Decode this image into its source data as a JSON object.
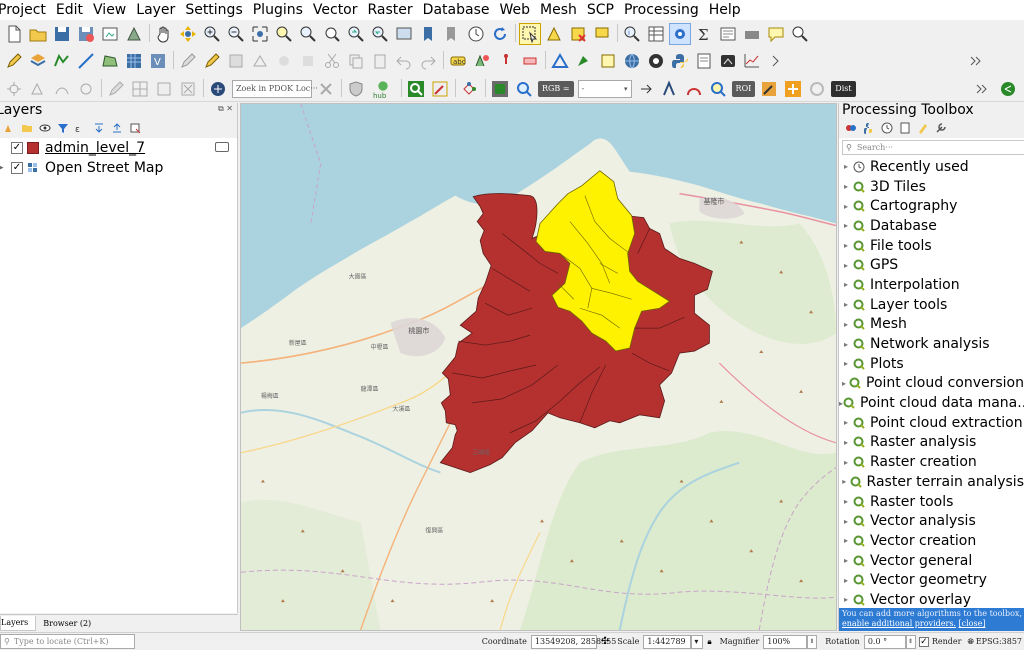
{
  "menu": [
    "Project",
    "Edit",
    "View",
    "Layer",
    "Settings",
    "Plugins",
    "Vector",
    "Raster",
    "Database",
    "Web",
    "Mesh",
    "SCP",
    "Processing",
    "Help"
  ],
  "toolbar3": {
    "pdok_placeholder": "Zoek in PDOK Loc···",
    "hub_label": "hub",
    "rgb_label": "RGB =",
    "roi_label": "ROI",
    "dist_label": "Dist"
  },
  "layers_panel": {
    "title": "Layers",
    "layers": [
      {
        "name": "admin_level_7",
        "checked": true,
        "symbol_color": "#b5312f"
      },
      {
        "name": "Open Street Map",
        "checked": true
      }
    ],
    "tabs": [
      "Layers",
      "Browser (2)"
    ],
    "locate_placeholder": "Type to locate (Ctrl+K)"
  },
  "processing_toolbox": {
    "title": "Processing Toolbox",
    "search_placeholder": "Search···",
    "providers": [
      "Recently used",
      "3D Tiles",
      "Cartography",
      "Database",
      "File tools",
      "GPS",
      "Interpolation",
      "Layer tools",
      "Mesh",
      "Network analysis",
      "Plots",
      "Point cloud conversion",
      "Point cloud data mana...",
      "Point cloud extraction",
      "Raster analysis",
      "Raster creation",
      "Raster terrain analysis",
      "Raster tools",
      "Vector analysis",
      "Vector creation",
      "Vector general",
      "Vector geometry",
      "Vector overlay"
    ],
    "banner_text": "You can add more algorithms to the toolbox,",
    "banner_link": "enable additional providers.",
    "banner_close": "[close]"
  },
  "map": {
    "labels": {
      "city_main": "桃園市",
      "city_north": "基隆市",
      "district_a": "大園區",
      "district_b": "新屋區",
      "district_c": "中壢區",
      "district_d": "楊梅區",
      "district_e": "龍潭區",
      "district_f": "大溪區",
      "district_g": "復興區",
      "district_h": "三峽區"
    },
    "fill_dark": "#b5312f",
    "fill_light": "#fff200"
  },
  "statusbar": {
    "coordinate_label": "Coordinate",
    "coordinate_value": "13549208, 2858555",
    "scale_label": "Scale",
    "scale_value": "1:442789",
    "magnifier_label": "Magnifier",
    "magnifier_value": "100%",
    "rotation_label": "Rotation",
    "rotation_value": "0.0 °",
    "render_label": "Render",
    "crs_label": "EPSG:3857"
  }
}
